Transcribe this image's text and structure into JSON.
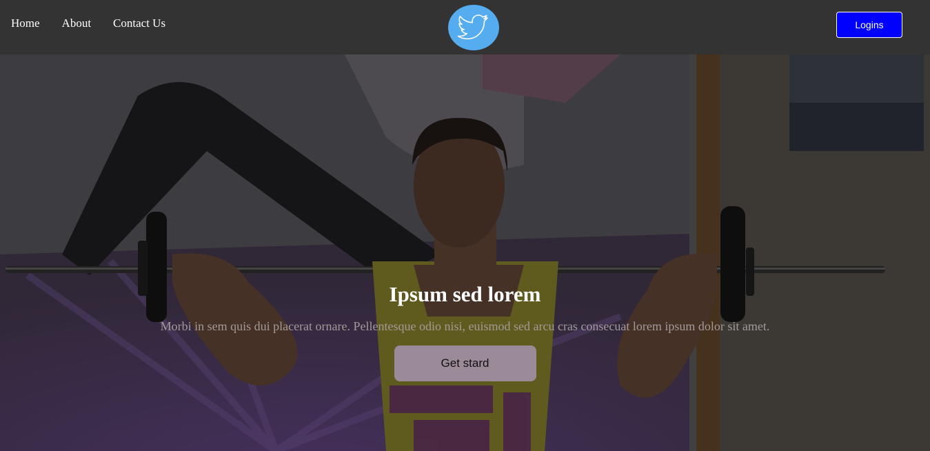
{
  "nav": {
    "links": [
      "Home",
      "About",
      "Contact Us"
    ],
    "logo_icon": "twitter-bird-icon",
    "login_label": "Logins"
  },
  "hero": {
    "title": "Ipsum sed lorem",
    "text": "Morbi in sem quis dui placerat ornare. Pellentesque odio nisi, euismod sed arcu cras consecuat lorem ipsum dolor sit amet.",
    "cta_label": "Get stard",
    "background_image": "woman-lifting-barbell-photo"
  },
  "colors": {
    "navbar": "#333333",
    "logo_circle": "#55acee",
    "login_button": "#0000ff",
    "cta_button": "#9b8b99",
    "hero_text": "#a39a9a"
  }
}
